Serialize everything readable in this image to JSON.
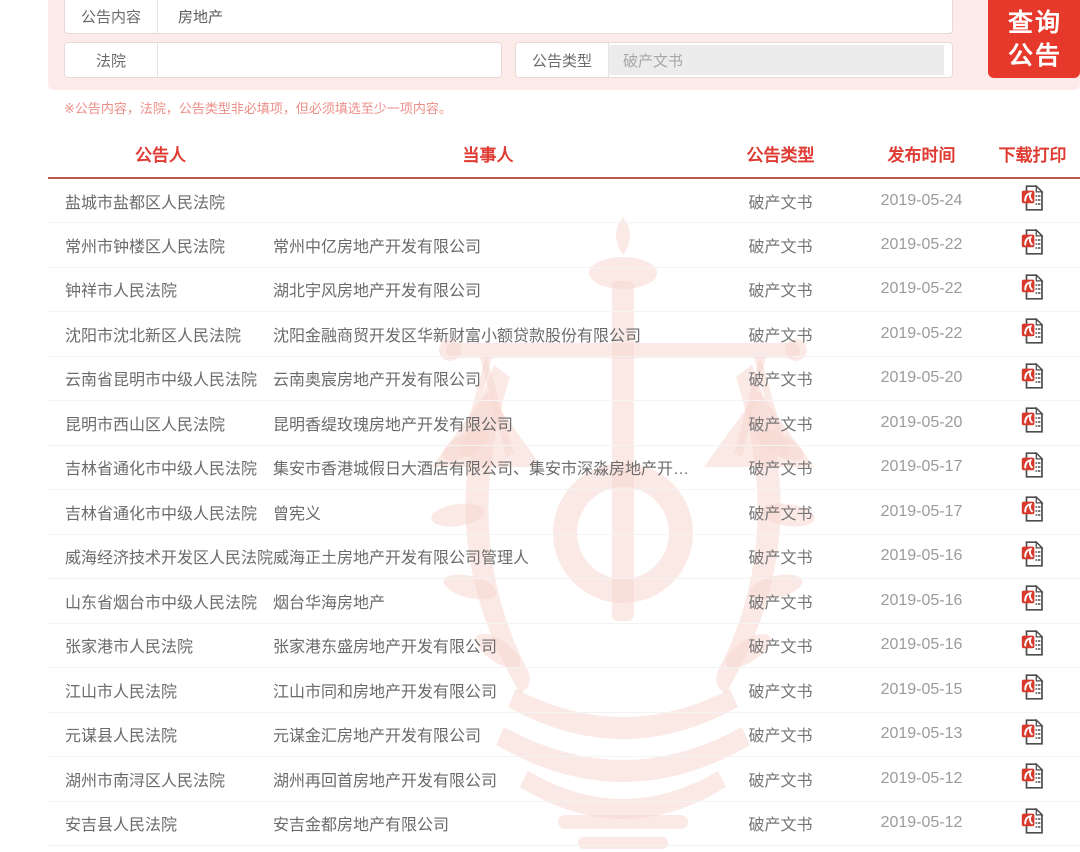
{
  "form": {
    "fields": [
      {
        "label": "公告内容",
        "value": "房地产"
      },
      {
        "label": "法院",
        "value": ""
      },
      {
        "label": "公告类型",
        "value": "破产文书"
      }
    ],
    "search_button": "查询公告",
    "note": "※公告内容，法院，公告类型非必填项，但必须填选至少一项内容。"
  },
  "table": {
    "headers": [
      "公告人",
      "当事人",
      "公告类型",
      "发布时间",
      "下载打印"
    ],
    "rows": [
      {
        "court": "盐城市盐都区人民法院",
        "party": "",
        "type": "破产文书",
        "date": "2019-05-24"
      },
      {
        "court": "常州市钟楼区人民法院",
        "party": "常州中亿房地产开发有限公司",
        "type": "破产文书",
        "date": "2019-05-22"
      },
      {
        "court": "钟祥市人民法院",
        "party": "湖北宇风房地产开发有限公司",
        "type": "破产文书",
        "date": "2019-05-22"
      },
      {
        "court": "沈阳市沈北新区人民法院",
        "party": "沈阳金融商贸开发区华新财富小额贷款股份有限公司",
        "type": "破产文书",
        "date": "2019-05-22"
      },
      {
        "court": "云南省昆明市中级人民法院",
        "party": "云南奥宸房地产开发有限公司",
        "type": "破产文书",
        "date": "2019-05-20"
      },
      {
        "court": "昆明市西山区人民法院",
        "party": "昆明香缇玫瑰房地产开发有限公司",
        "type": "破产文书",
        "date": "2019-05-20"
      },
      {
        "court": "吉林省通化市中级人民法院",
        "party": "集安市香港城假日大酒店有限公司、集安市深淼房地产开…",
        "type": "破产文书",
        "date": "2019-05-17"
      },
      {
        "court": "吉林省通化市中级人民法院",
        "party": "曾宪义",
        "type": "破产文书",
        "date": "2019-05-17"
      },
      {
        "court": "威海经济技术开发区人民法院",
        "party": "威海正土房地产开发有限公司管理人",
        "type": "破产文书",
        "date": "2019-05-16"
      },
      {
        "court": "山东省烟台市中级人民法院",
        "party": "烟台华海房地产",
        "type": "破产文书",
        "date": "2019-05-16"
      },
      {
        "court": "张家港市人民法院",
        "party": "张家港东盛房地产开发有限公司",
        "type": "破产文书",
        "date": "2019-05-16"
      },
      {
        "court": "江山市人民法院",
        "party": "江山市同和房地产开发有限公司",
        "type": "破产文书",
        "date": "2019-05-15"
      },
      {
        "court": "元谋县人民法院",
        "party": "元谋金汇房地产开发有限公司",
        "type": "破产文书",
        "date": "2019-05-13"
      },
      {
        "court": "湖州市南浔区人民法院",
        "party": "湖州再回首房地产开发有限公司",
        "type": "破产文书",
        "date": "2019-05-12"
      },
      {
        "court": "安吉县人民法院",
        "party": "安吉金都房地产有限公司",
        "type": "破产文书",
        "date": "2019-05-12"
      }
    ],
    "download_icon": "pdf-file-icon"
  },
  "colors": {
    "accent_red": "#e6392c",
    "header_red": "#df3b33",
    "header_rule": "#bb594b",
    "panel_pink": "#fcebe8",
    "note_pink": "#ec8e88",
    "watermark_pink": "#f7d7d0",
    "body_text": "#6b6b6b",
    "date_text": "#9b9b9b"
  }
}
